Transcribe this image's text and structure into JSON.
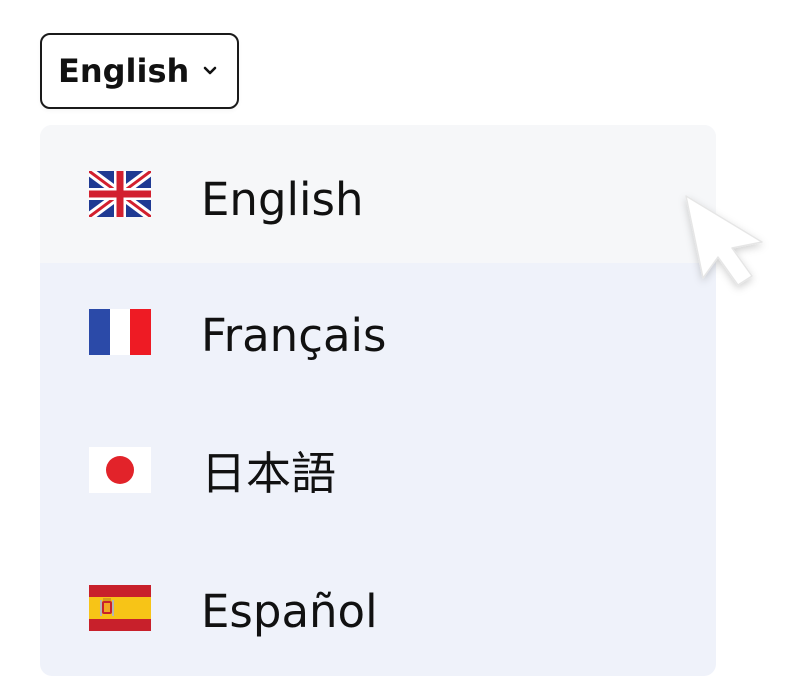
{
  "selector": {
    "label": "English",
    "icon": "chevron-down-icon"
  },
  "menu": {
    "items": [
      {
        "label": "English",
        "flag": "flag-uk-icon",
        "active": true
      },
      {
        "label": "Français",
        "flag": "flag-france-icon",
        "active": false
      },
      {
        "label": "日本語",
        "flag": "flag-japan-icon",
        "active": false
      },
      {
        "label": "Español",
        "flag": "flag-spain-icon",
        "active": false
      }
    ]
  },
  "colors": {
    "menu_background": "#eff2fa",
    "active_item_background": "#f6f7f9",
    "text": "#111111",
    "border": "#1a1a1a"
  },
  "cursor": {
    "icon": "mouse-pointer-icon"
  }
}
